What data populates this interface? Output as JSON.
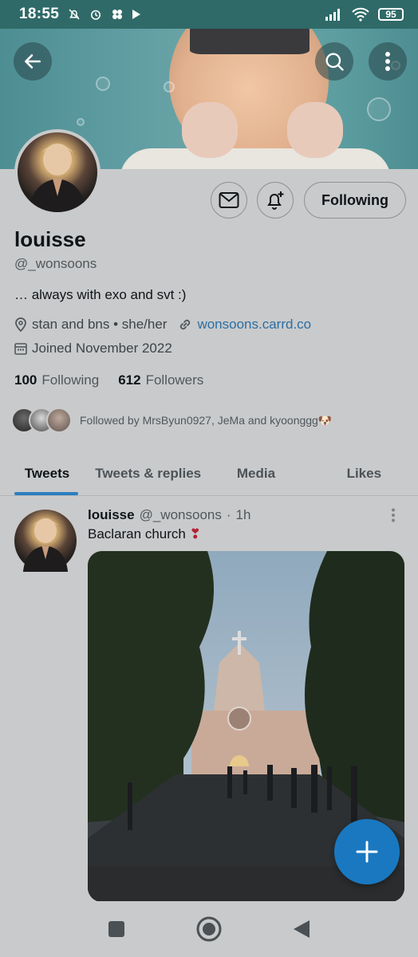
{
  "status_bar": {
    "time": "18:55",
    "battery": "95",
    "left_icons": [
      "mute-icon",
      "alarm-icon",
      "clover-icon",
      "play-icon"
    ],
    "right_icons": [
      "signal-icon",
      "wifi-icon",
      "battery-icon"
    ]
  },
  "profile": {
    "name": "louisse",
    "handle": "@_wonsoons",
    "bio": "… always with exo and svt :)",
    "location": "stan and bns • she/her",
    "website": "wonsoons.carrd.co",
    "joined": "Joined November 2022",
    "following_count": "100",
    "following_label": "Following",
    "followers_count": "612",
    "followers_label": "Followers",
    "followed_by": "Followed by MrsByun0927, JeMa and kyoonggg🐶"
  },
  "actions": {
    "follow_button": "Following"
  },
  "tabs": [
    {
      "label": "Tweets",
      "active": true
    },
    {
      "label": "Tweets & replies",
      "active": false
    },
    {
      "label": "Media",
      "active": false
    },
    {
      "label": "Likes",
      "active": false
    }
  ],
  "tweet": {
    "name": "louisse",
    "handle": "@_wonsoons",
    "separator": "·",
    "time": "1h",
    "text": "Baclaran church",
    "emoji": "❣"
  },
  "colors": {
    "accent": "#1a78c0",
    "link": "#2b6ea3",
    "status_bar": "#2f6a68",
    "background": "#c9cacb"
  }
}
